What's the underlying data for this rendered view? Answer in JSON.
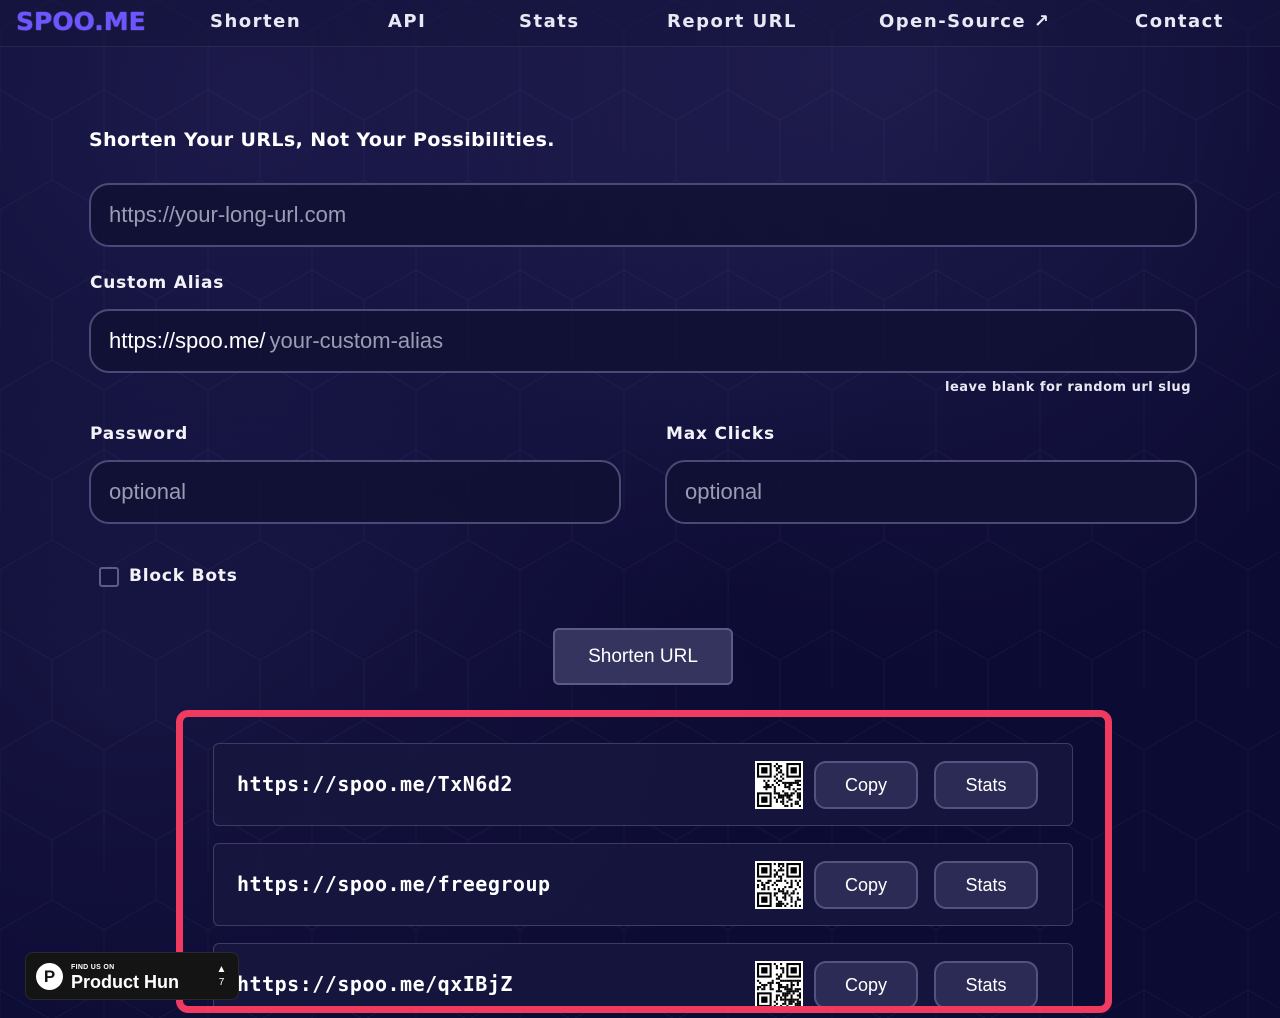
{
  "nav": {
    "logo": "SPOO.ME",
    "links": [
      "Shorten",
      "API",
      "Stats",
      "Report URL",
      "Open-Source ↗",
      "Contact"
    ]
  },
  "form": {
    "tagline": "Shorten Your URLs, Not Your Possibilities.",
    "url_placeholder": "https://your-long-url.com",
    "alias_label": "Custom Alias",
    "alias_prefix": "https://spoo.me/",
    "alias_placeholder": "your-custom-alias",
    "alias_hint": "leave blank for random url slug",
    "password_label": "Password",
    "password_placeholder": "optional",
    "max_clicks_label": "Max Clicks",
    "max_clicks_placeholder": "optional",
    "block_bots_label": "Block Bots",
    "block_bots_checked": false,
    "submit_label": "Shorten URL"
  },
  "results": [
    {
      "url": "https://spoo.me/TxN6d2",
      "copy_label": "Copy",
      "stats_label": "Stats"
    },
    {
      "url": "https://spoo.me/freegroup",
      "copy_label": "Copy",
      "stats_label": "Stats"
    },
    {
      "url": "https://spoo.me/qxIBjZ",
      "copy_label": "Copy",
      "stats_label": "Stats"
    }
  ],
  "product_hunt": {
    "small_text": "FIND US ON",
    "big_text": "Product Hunt",
    "logo_letter": "P",
    "arrow": "▲",
    "vote_count": "7"
  },
  "colors": {
    "background": "#0c0b33",
    "logo": "#6d55ff",
    "highlight": "#f03a60"
  }
}
